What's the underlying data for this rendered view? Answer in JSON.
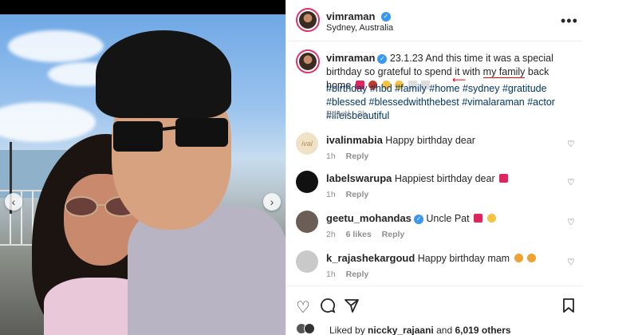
{
  "post": {
    "author": "vimraman",
    "location": "Sydney, Australia",
    "more_label": "•••",
    "caption_date": "23.1.23",
    "caption_pre": "And this time it was a special birthday so grateful to spend it with",
    "caption_underlined": "my family",
    "caption_post": "back home",
    "hashtags": "#birthday #hbd #family #home #sydney #gratitude #blessed #blessedwiththebest #vimalaraman #actor #lifeisbeautiful",
    "edited_label": "Edited",
    "edited_time": "2h"
  },
  "comments": [
    {
      "user": "ivalinmabia",
      "text": "Happy birthday dear",
      "time": "1h",
      "likes": "",
      "reply": "Reply"
    },
    {
      "user": "labelswarupa",
      "text": "Happiest birthday dear",
      "time": "1h",
      "likes": "",
      "reply": "Reply"
    },
    {
      "user": "geetu_mohandas",
      "text": "Uncle Pat",
      "time": "2h",
      "likes": "6 likes",
      "reply": "Reply"
    },
    {
      "user": "k_rajashekargoud",
      "text": "Happy birthday mam",
      "time": "1h",
      "likes": "",
      "reply": "Reply"
    }
  ],
  "footer": {
    "liked_prefix": "Liked by",
    "liked_user": "niccky_rajaani",
    "liked_and": "and",
    "liked_count": "6,019 others"
  },
  "icons": {
    "heart": "heart-icon",
    "comment": "comment-icon",
    "share": "share-icon",
    "save": "bookmark-icon",
    "more": "more-icon",
    "verified": "verified-icon"
  },
  "colors": {
    "link": "#00376b",
    "verified": "#3897f0",
    "underline": "#ee0000",
    "muted": "#8e8e8e"
  }
}
